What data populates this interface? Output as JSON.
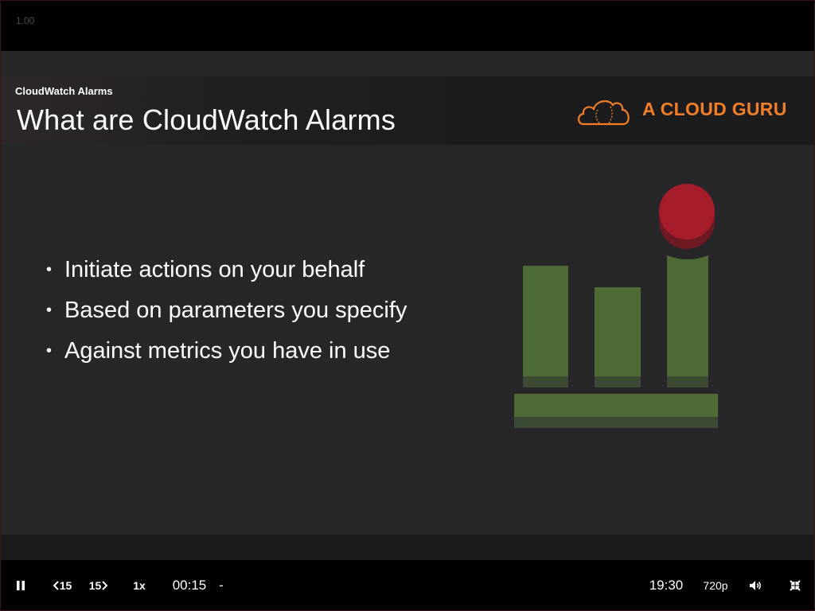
{
  "topbar": {
    "version": "1.00"
  },
  "slide": {
    "subtitle": "CloudWatch Alarms",
    "title": "What are CloudWatch Alarms",
    "logo_text": "A CLOUD GURU",
    "bullets": [
      "Initiate actions on your behalf",
      "Based on parameters you specify",
      "Against metrics you have in use"
    ],
    "bullet_glyph": "•"
  },
  "colors": {
    "brand_orange": "#f37e28",
    "bar_green": "#4e6b36",
    "alarm_red": "#a51d2b",
    "slide_bg": "#272628"
  },
  "player": {
    "play_state_icon": "pause-icon",
    "rewind_label": "15",
    "forward_label": "15",
    "speed_label": "1x",
    "current_time": "00:15",
    "separator": "-",
    "duration": "19:30",
    "quality_label": "720p",
    "volume_icon": "volume-icon",
    "fullscreen_icon": "exit-fullscreen-icon"
  }
}
